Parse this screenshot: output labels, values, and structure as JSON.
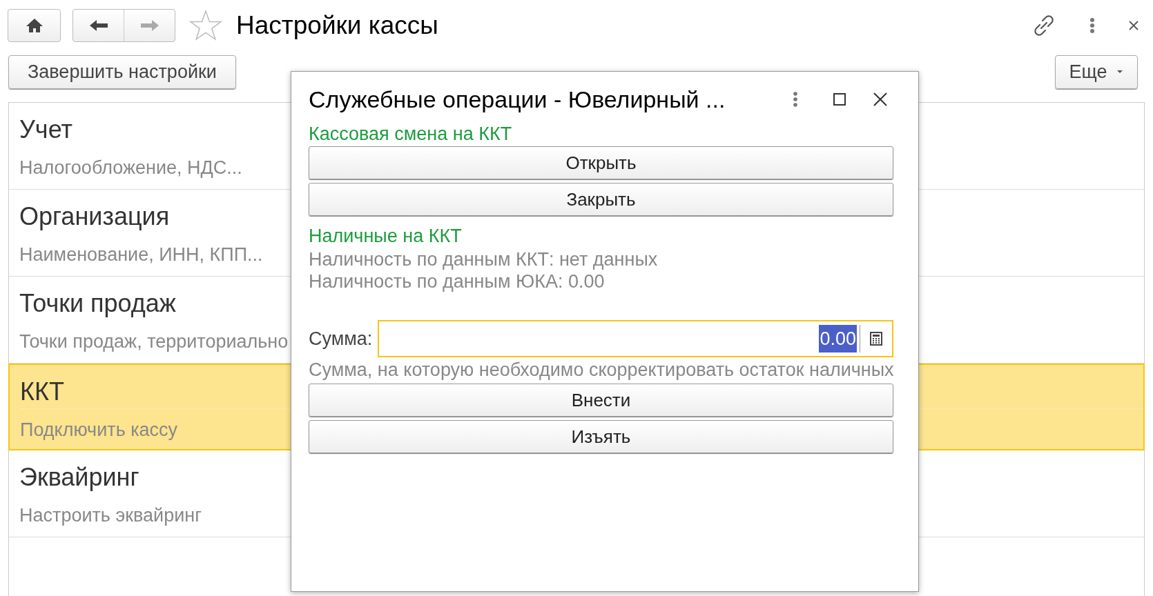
{
  "window": {
    "title": "Настройки кассы"
  },
  "toolbar": {
    "finish_button": "Завершить настройки",
    "more_button": "Еще"
  },
  "sections": [
    {
      "title": "Учет",
      "subtitle": "Налогообложение, НДС...",
      "selected": false
    },
    {
      "title": "Организация",
      "subtitle": "Наименование, ИНН, КПП...",
      "selected": false
    },
    {
      "title": "Точки продаж",
      "subtitle": "Точки продаж, территориально",
      "selected": false
    },
    {
      "title": "ККТ",
      "subtitle": "Подключить кассу",
      "selected": true
    },
    {
      "title": "Эквайринг",
      "subtitle": "Настроить эквайринг",
      "selected": false
    }
  ],
  "dialog": {
    "title": "Служебные операции - Ювелирный ...",
    "shift_group": {
      "title": "Кассовая смена на ККТ",
      "buttons": [
        "Открыть",
        "Закрыть"
      ]
    },
    "cash_group": {
      "title": "Наличные на ККТ",
      "lines": [
        "Наличность по данным ККТ: нет данных",
        "Наличность по данным ЮКА: 0.00"
      ]
    },
    "amount": {
      "label": "Сумма:",
      "value": "0.00",
      "hint": "Сумма, на которую необходимо скорректировать остаток наличных"
    },
    "buttons": [
      "Внести",
      "Изъять"
    ]
  }
}
